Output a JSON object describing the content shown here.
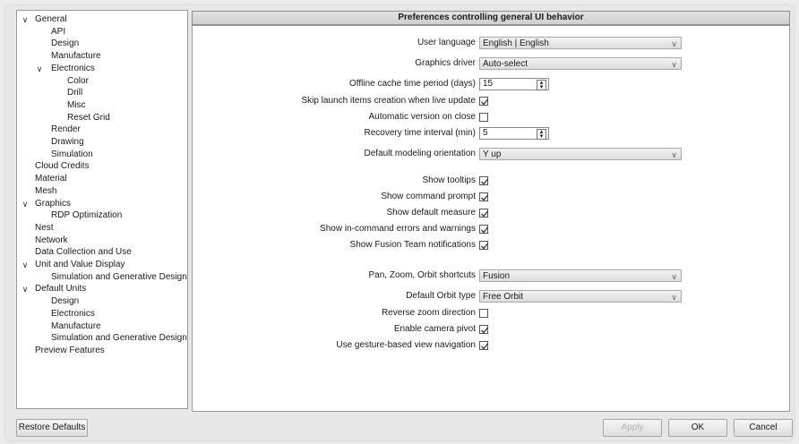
{
  "sidebar": {
    "items": [
      {
        "label": "General",
        "caret": "expanded"
      },
      {
        "label": "API"
      },
      {
        "label": "Design"
      },
      {
        "label": "Manufacture"
      },
      {
        "label": "Electronics",
        "caret": "expanded"
      },
      {
        "label": "Color"
      },
      {
        "label": "Drill"
      },
      {
        "label": "Misc"
      },
      {
        "label": "Reset Grid"
      },
      {
        "label": "Render"
      },
      {
        "label": "Drawing"
      },
      {
        "label": "Simulation"
      },
      {
        "label": "Cloud Credits"
      },
      {
        "label": "Material"
      },
      {
        "label": "Mesh"
      },
      {
        "label": "Graphics",
        "caret": "expanded"
      },
      {
        "label": "RDP Optimization"
      },
      {
        "label": "Nest"
      },
      {
        "label": "Network"
      },
      {
        "label": "Data Collection and Use"
      },
      {
        "label": "Unit and Value Display",
        "caret": "expanded"
      },
      {
        "label": "Simulation and Generative Design"
      },
      {
        "label": "Default Units",
        "caret": "expanded"
      },
      {
        "label": "Design"
      },
      {
        "label": "Electronics"
      },
      {
        "label": "Manufacture"
      },
      {
        "label": "Simulation and Generative Design"
      },
      {
        "label": "Preview Features"
      }
    ]
  },
  "main": {
    "header": "Preferences controlling general UI behavior",
    "user_language": {
      "label": "User language",
      "value": "English | English"
    },
    "graphics_driver": {
      "label": "Graphics driver",
      "value": "Auto-select"
    },
    "offline_cache": {
      "label": "Offline cache time period (days)",
      "value": "15"
    },
    "skip_launch": {
      "label": "Skip launch items creation when live update",
      "checked": true
    },
    "auto_version": {
      "label": "Automatic version on close",
      "checked": false
    },
    "recovery": {
      "label": "Recovery time interval (min)",
      "value": "5"
    },
    "orientation": {
      "label": "Default modeling orientation",
      "value": "Y up"
    },
    "show_tooltips": {
      "label": "Show tooltips",
      "checked": true
    },
    "show_command_prompt": {
      "label": "Show command prompt",
      "checked": true
    },
    "show_default_measure": {
      "label": "Show default measure",
      "checked": true
    },
    "show_in_command_errors": {
      "label": "Show in-command errors and warnings",
      "checked": true
    },
    "show_fusion_team": {
      "label": "Show Fusion Team notifications",
      "checked": true
    },
    "pan_zoom": {
      "label": "Pan, Zoom, Orbit shortcuts",
      "value": "Fusion"
    },
    "orbit_type": {
      "label": "Default Orbit type",
      "value": "Free Orbit"
    },
    "reverse_zoom": {
      "label": "Reverse zoom direction",
      "checked": false
    },
    "camera_pivot": {
      "label": "Enable camera pivot",
      "checked": true
    },
    "gesture_nav": {
      "label": "Use gesture-based view navigation",
      "checked": true
    }
  },
  "footer": {
    "restore_defaults": "Restore Defaults",
    "apply": "Apply",
    "ok": "OK",
    "cancel": "Cancel"
  },
  "icons": {
    "caret": "chevron-down-icon",
    "dropdown_arrow": "chevron-down-icon",
    "spinner": "spinner-arrows-icon",
    "check": "checkmark-icon"
  }
}
